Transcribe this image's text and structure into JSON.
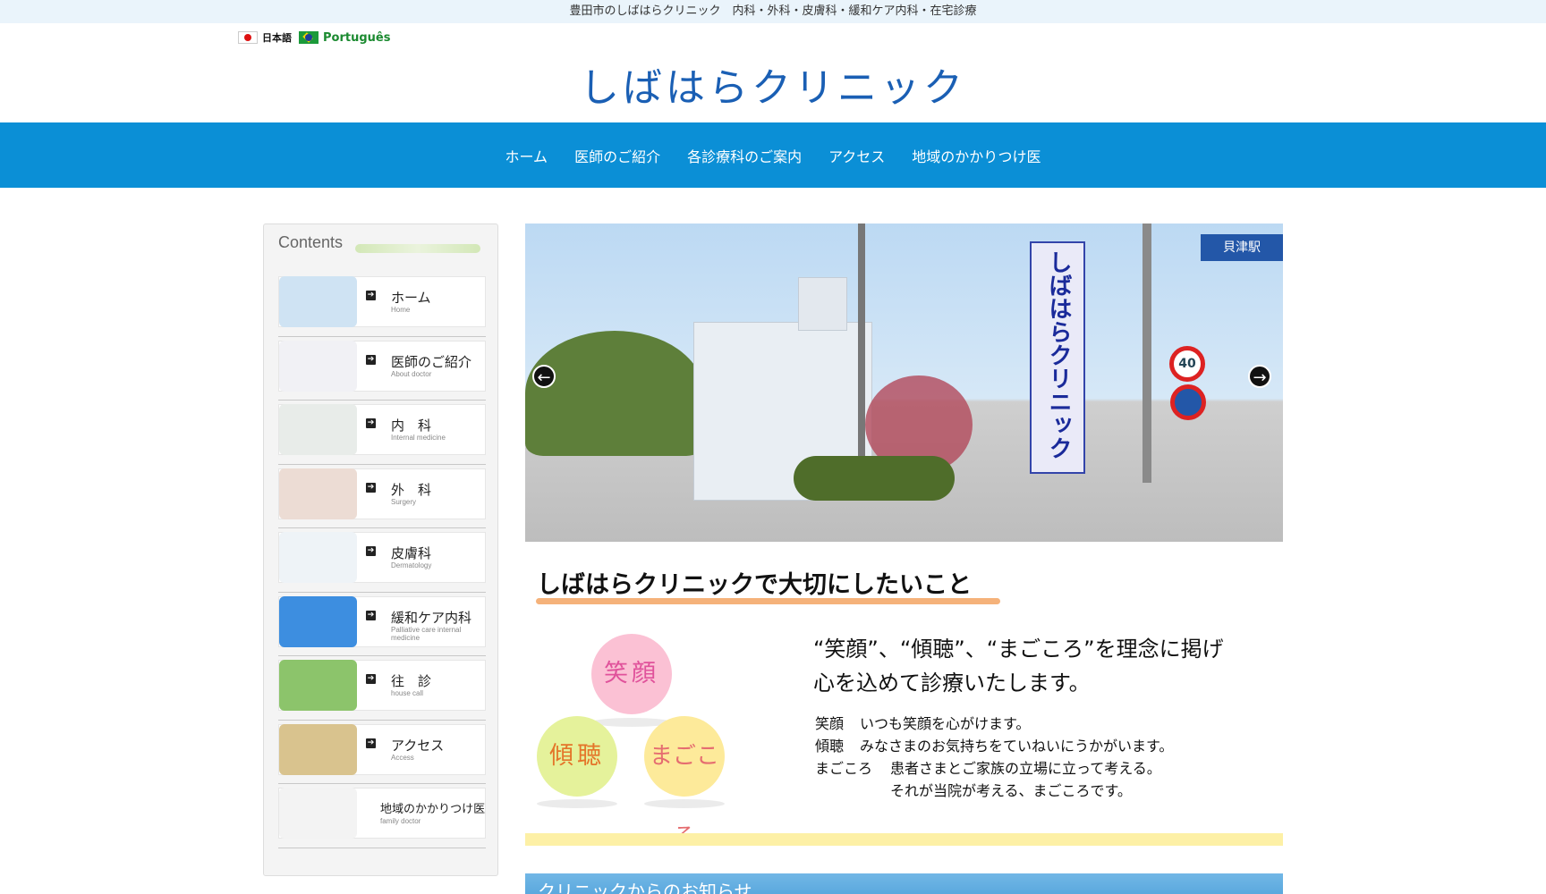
{
  "topbar": {
    "text": "豊田市のしばはらクリニック　内科・外科・皮膚科・緩和ケア内科・在宅診療"
  },
  "lang": {
    "jp": "日本語",
    "pt": "Português"
  },
  "logo": {
    "text": "しばはらクリニック"
  },
  "nav": {
    "items": [
      "ホーム",
      "医師のご紹介",
      "各診療科のご案内",
      "アクセス",
      "地域のかかりつけ医"
    ]
  },
  "sidebar": {
    "title": "Contents",
    "items": [
      {
        "label": "ホーム",
        "sub": "Home",
        "thumb_color": "#cfe3f3"
      },
      {
        "label": "医師のご紹介",
        "sub": "About doctor",
        "thumb_color": "#f1f1f5"
      },
      {
        "label": "内　科",
        "sub": "Internal medicine",
        "thumb_color": "#e8ece9"
      },
      {
        "label": "外　科",
        "sub": "Surgery",
        "thumb_color": "#ecdcd4"
      },
      {
        "label": "皮膚科",
        "sub": "Dermatology",
        "thumb_color": "#eef3f7"
      },
      {
        "label": "緩和ケア内科",
        "sub": "Palliative care internal medicine",
        "thumb_color": "#3d8ee0"
      },
      {
        "label": "往　診",
        "sub": "house call",
        "thumb_color": "#8cc46b"
      },
      {
        "label": "アクセス",
        "sub": "Access",
        "thumb_color": "#d9c38e"
      },
      {
        "label": "地域のかかりつけ医",
        "sub": "family doctor",
        "thumb_color": "#f3f3f3"
      }
    ]
  },
  "hero": {
    "sign_text": "しばはらクリニック",
    "station_sign": "貝津駅",
    "speed_limit": "40",
    "prev_label": "←",
    "next_label": "→"
  },
  "section": {
    "title": "しばはらクリニックで大切にしたいこと",
    "circles": {
      "egao": "笑顔",
      "keicho": "傾聴",
      "magokoro": "まごころ"
    },
    "motto_line1": "“笑顔”、“傾聴”、“まごころ”を理念に掲げ",
    "motto_line2": "心を込めて診療いたします。",
    "lines": [
      {
        "key": "笑顔",
        "text": "いつも笑顔を心がけます。"
      },
      {
        "key": "傾聴",
        "text": "みなさまのお気持ちをていねいにうかがいます。"
      },
      {
        "key": "まごころ",
        "text": "患者さまとご家族の立場に立って考える。"
      },
      {
        "key": "",
        "text": "それが当院が考える、まごころです。"
      }
    ]
  },
  "news": {
    "title": "クリニックからのお知らせ"
  },
  "colors": {
    "nav_bg": "#0b8fd6",
    "logo": "#1a5fb4",
    "topbar_bg": "#eaf4fb"
  }
}
